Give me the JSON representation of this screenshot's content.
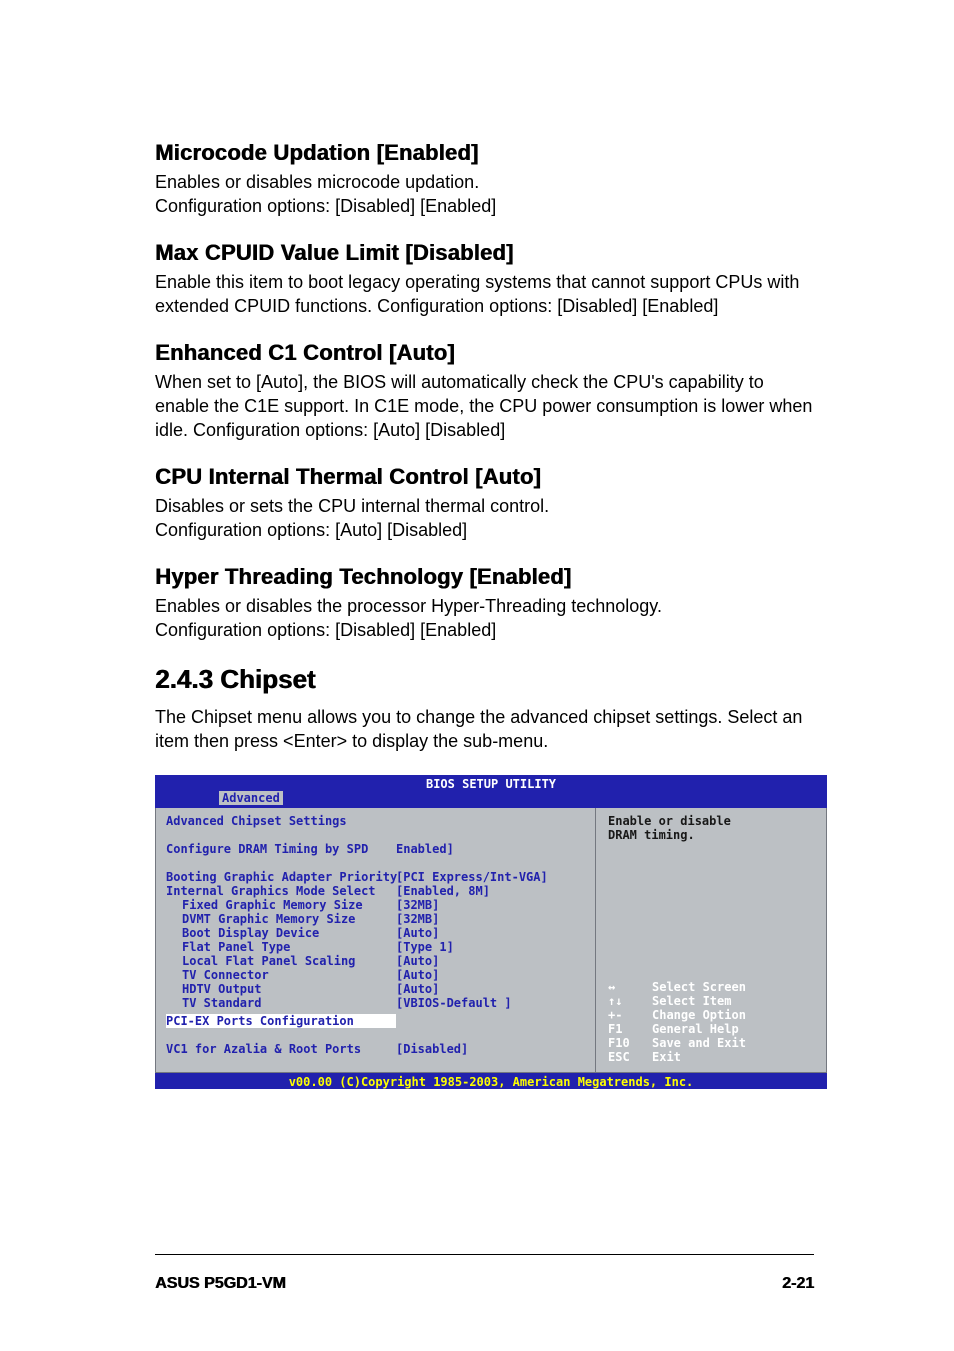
{
  "sections": [
    {
      "heading": "Microcode Updation [Enabled]",
      "desc": "Enables or disables microcode updation.\nConfiguration options: [Disabled] [Enabled]"
    },
    {
      "heading": "Max CPUID Value Limit [Disabled]",
      "desc": "Enable this item to boot legacy operating systems that cannot support CPUs with extended CPUID functions. Configuration options: [Disabled] [Enabled]"
    },
    {
      "heading": "Enhanced C1 Control [Auto]",
      "desc": "When set to [Auto], the BIOS will automatically check the CPU's capability to enable the C1E support. In C1E mode, the CPU power consumption is lower when idle. Configuration options: [Auto] [Disabled]"
    },
    {
      "heading": "CPU Internal Thermal Control [Auto]",
      "desc": "Disables or sets the CPU internal thermal control.\nConfiguration options:  [Auto] [Disabled]"
    },
    {
      "heading": "Hyper Threading Technology [Enabled]",
      "desc": "Enables or disables the processor Hyper-Threading technology.\nConfiguration options:  [Disabled] [Enabled]"
    }
  ],
  "chipset_heading": "2.4.3   Chipset",
  "chipset_intro": "The Chipset menu allows you to change the advanced chipset settings. Select an item then press <Enter> to display the sub-menu.",
  "bios": {
    "title": "BIOS SETUP UTILITY",
    "tab": "Advanced",
    "left_heading": "Advanced Chipset Settings",
    "rows1": [
      {
        "label": "Configure DRAM Timing by SPD",
        "value": "Enabled]",
        "indent": 0
      }
    ],
    "rows2": [
      {
        "label": "Booting Graphic Adapter Priority",
        "value": "[PCI Express/Int-VGA]",
        "indent": 0
      },
      {
        "label": "Internal Graphics Mode Select",
        "value": "[Enabled, 8M]",
        "indent": 0
      },
      {
        "label": "Fixed Graphic Memory Size",
        "value": "[32MB]",
        "indent": 1
      },
      {
        "label": "DVMT Graphic Memory Size",
        "value": "[32MB]",
        "indent": 1
      },
      {
        "label": "Boot Display Device",
        "value": "[Auto]",
        "indent": 1
      },
      {
        "label": "Flat Panel Type",
        "value": "[Type 1]",
        "indent": 1
      },
      {
        "label": "Local Flat Panel Scaling",
        "value": "[Auto]",
        "indent": 1
      },
      {
        "label": "TV Connector",
        "value": "[Auto]",
        "indent": 1
      },
      {
        "label": "HDTV Output",
        "value": "[Auto]",
        "indent": 1
      },
      {
        "label": "TV Standard",
        "value": "[VBIOS-Default ]",
        "indent": 1
      }
    ],
    "selected_row": {
      "label": "PCI-EX Ports Configuration",
      "value": ""
    },
    "rows3": [
      {
        "label": "VC1 for Azalia & Root Ports",
        "value": "[Disabled]",
        "indent": 0
      }
    ],
    "help_text": "Enable or disable\nDRAM timing.",
    "legend": [
      {
        "key": "↔",
        "val": "Select Screen"
      },
      {
        "key": "↑↓",
        "val": "Select Item"
      },
      {
        "key": "+-",
        "val": "Change Option"
      },
      {
        "key": "F1",
        "val": "General Help"
      },
      {
        "key": "F10",
        "val": "Save and Exit"
      },
      {
        "key": "ESC",
        "val": "Exit"
      }
    ],
    "footer": "v00.00 (C)Copyright 1985-2003, American Megatrends, Inc."
  },
  "page_footer": {
    "left": "ASUS P5GD1-VM",
    "right": "2-21"
  }
}
